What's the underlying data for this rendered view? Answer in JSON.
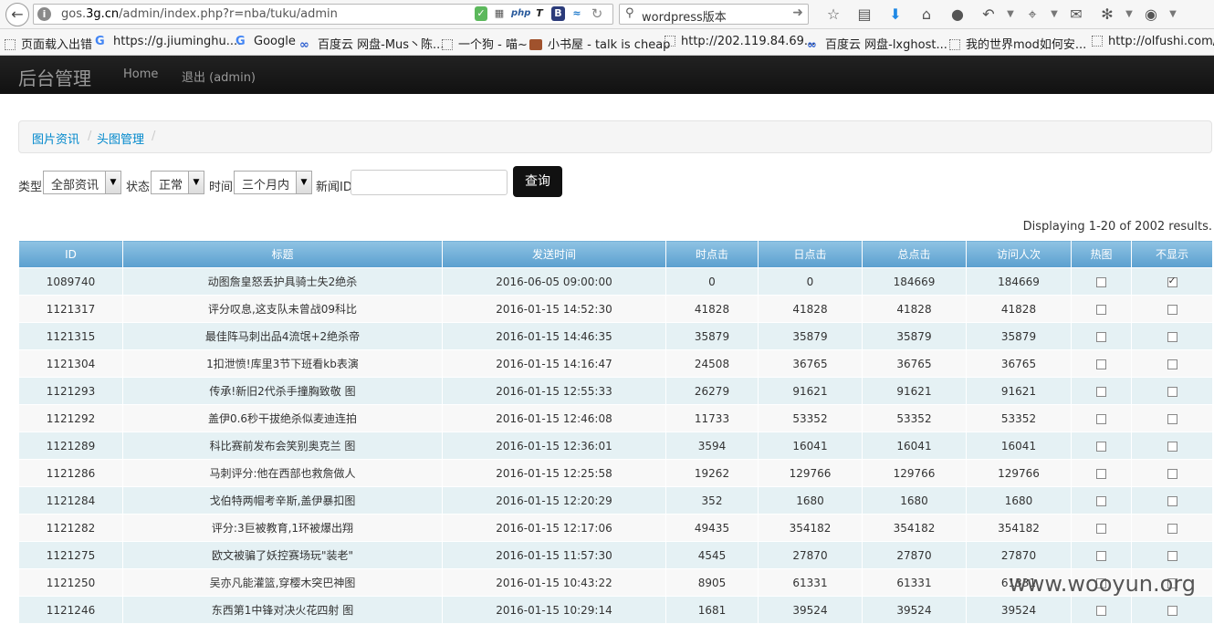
{
  "browser": {
    "url": "gos.3g.cn/admin/index.php?r=nba/tuku/admin",
    "url_domain": "3g.cn",
    "url_prefix": "gos.",
    "url_suffix": "/admin/index.php?r=nba/tuku/admin",
    "search_value": "wordpress版本",
    "url_icon_php": "php",
    "url_icon_b": "B"
  },
  "bookmarks": [
    "页面载入出错",
    "https://g.jiuminghu....",
    "Google",
    "百度云 网盘-Mus丶陈...",
    "一个狗 - 喵~",
    "小书屋 - talk is cheap",
    "http://202.119.84.69...",
    "百度云 网盘-lxghost...",
    "我的世界mod如何安...",
    "http://olfushi.com/"
  ],
  "app": {
    "brand": "后台管理",
    "nav_home": "Home",
    "nav_logout": "退出 (admin)"
  },
  "breadcrumb": {
    "item1": "图片资讯",
    "item2": "头图管理",
    "separator": "/"
  },
  "filters": {
    "type_label": "类型",
    "type_value": "全部资讯",
    "status_label": "状态",
    "status_value": "正常",
    "time_label": "时间",
    "time_value": "三个月内",
    "news_id_label": "新闻ID",
    "news_id_value": "",
    "query_button": "查询"
  },
  "summary": "Displaying 1-20 of 2002 results.",
  "table": {
    "headers": [
      "ID",
      "标题",
      "发送时间",
      "时点击",
      "日点击",
      "总点击",
      "访问人次",
      "热图",
      "不显示"
    ],
    "rows": [
      {
        "id": "1089740",
        "title": "动图詹皇怒丢护具骑士失2绝杀",
        "time": "2016-06-05 09:00:00",
        "h": "0",
        "d": "0",
        "t": "184669",
        "v": "184669",
        "hot": false,
        "hide": true
      },
      {
        "id": "1121317",
        "title": "评分叹息,这支队未曾战09科比",
        "time": "2016-01-15 14:52:30",
        "h": "41828",
        "d": "41828",
        "t": "41828",
        "v": "41828",
        "hot": false,
        "hide": false
      },
      {
        "id": "1121315",
        "title": "最佳阵马刺出品4流氓+2绝杀帝",
        "time": "2016-01-15 14:46:35",
        "h": "35879",
        "d": "35879",
        "t": "35879",
        "v": "35879",
        "hot": false,
        "hide": false
      },
      {
        "id": "1121304",
        "title": "1扣泄愤!库里3节下班看kb表演",
        "time": "2016-01-15 14:16:47",
        "h": "24508",
        "d": "36765",
        "t": "36765",
        "v": "36765",
        "hot": false,
        "hide": false
      },
      {
        "id": "1121293",
        "title": "传承!新旧2代杀手撞胸致敬 图",
        "time": "2016-01-15 12:55:33",
        "h": "26279",
        "d": "91621",
        "t": "91621",
        "v": "91621",
        "hot": false,
        "hide": false
      },
      {
        "id": "1121292",
        "title": "盖伊0.6秒干拔绝杀似麦迪连拍",
        "time": "2016-01-15 12:46:08",
        "h": "11733",
        "d": "53352",
        "t": "53352",
        "v": "53352",
        "hot": false,
        "hide": false
      },
      {
        "id": "1121289",
        "title": "科比赛前发布会笑别奥克兰 图",
        "time": "2016-01-15 12:36:01",
        "h": "3594",
        "d": "16041",
        "t": "16041",
        "v": "16041",
        "hot": false,
        "hide": false
      },
      {
        "id": "1121286",
        "title": "马刺评分:他在西部也救詹做人",
        "time": "2016-01-15 12:25:58",
        "h": "19262",
        "d": "129766",
        "t": "129766",
        "v": "129766",
        "hot": false,
        "hide": false
      },
      {
        "id": "1121284",
        "title": "戈伯特两帽考辛斯,盖伊暴扣图",
        "time": "2016-01-15 12:20:29",
        "h": "352",
        "d": "1680",
        "t": "1680",
        "v": "1680",
        "hot": false,
        "hide": false
      },
      {
        "id": "1121282",
        "title": "评分:3巨被教育,1环被爆出翔",
        "time": "2016-01-15 12:17:06",
        "h": "49435",
        "d": "354182",
        "t": "354182",
        "v": "354182",
        "hot": false,
        "hide": false
      },
      {
        "id": "1121275",
        "title": "欧文被骗了妖控赛场玩\"装老\"",
        "time": "2016-01-15 11:57:30",
        "h": "4545",
        "d": "27870",
        "t": "27870",
        "v": "27870",
        "hot": false,
        "hide": false
      },
      {
        "id": "1121250",
        "title": "吴亦凡能灌篮,穿樱木突巴神图",
        "time": "2016-01-15 10:43:22",
        "h": "8905",
        "d": "61331",
        "t": "61331",
        "v": "61331",
        "hot": false,
        "hide": false
      },
      {
        "id": "1121246",
        "title": "东西第1中锋对决火花四射 图",
        "time": "2016-01-15 10:29:14",
        "h": "1681",
        "d": "39524",
        "t": "39524",
        "v": "39524",
        "hot": false,
        "hide": false
      }
    ]
  },
  "watermark": "www.wooyun.org"
}
